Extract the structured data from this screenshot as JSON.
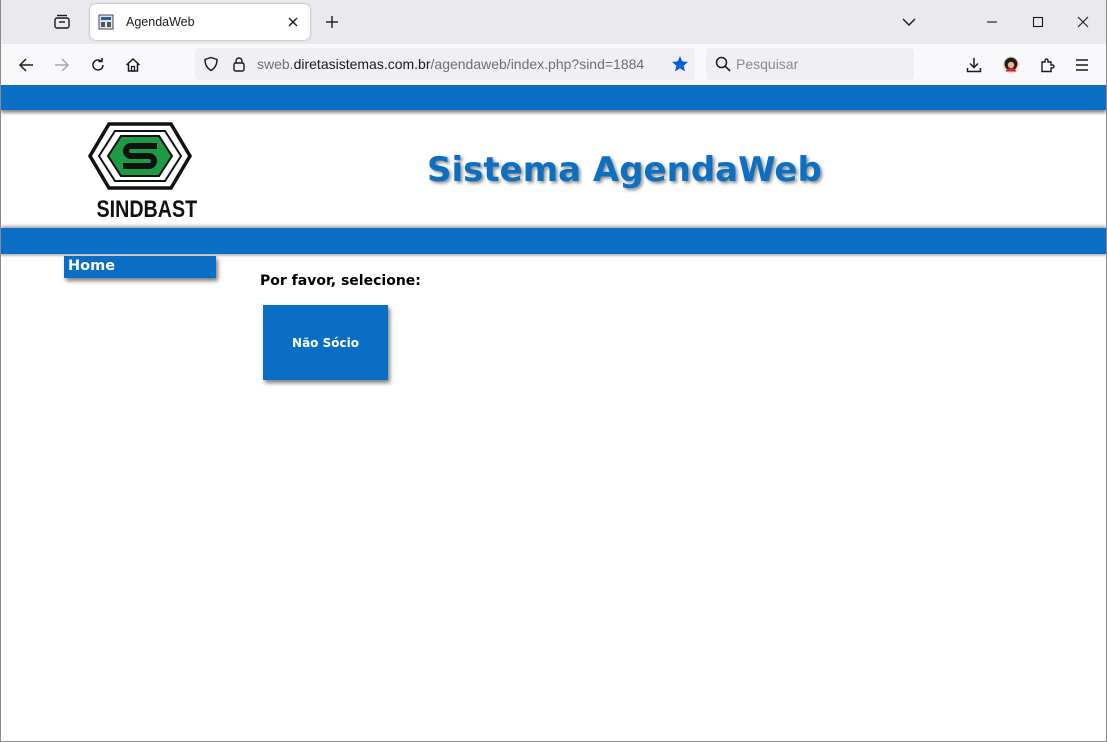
{
  "browser": {
    "tab": {
      "title": "AgendaWeb"
    },
    "url": {
      "prefix": "sweb.",
      "host": "diretasistemas.com.br",
      "path": "/agendaweb/index.php?sind=1884"
    },
    "search": {
      "placeholder": "Pesquisar"
    }
  },
  "page": {
    "logo_text": "SINDBAST",
    "title": "Sistema AgendaWeb",
    "menu": {
      "home": "Home"
    },
    "prompt": "Por favor, selecione:",
    "options": [
      {
        "label": "Não Sócio"
      }
    ]
  },
  "colors": {
    "brand_blue": "#0a6fc4",
    "logo_green": "#1e9a45",
    "bookmark_blue": "#0b5ed7"
  }
}
